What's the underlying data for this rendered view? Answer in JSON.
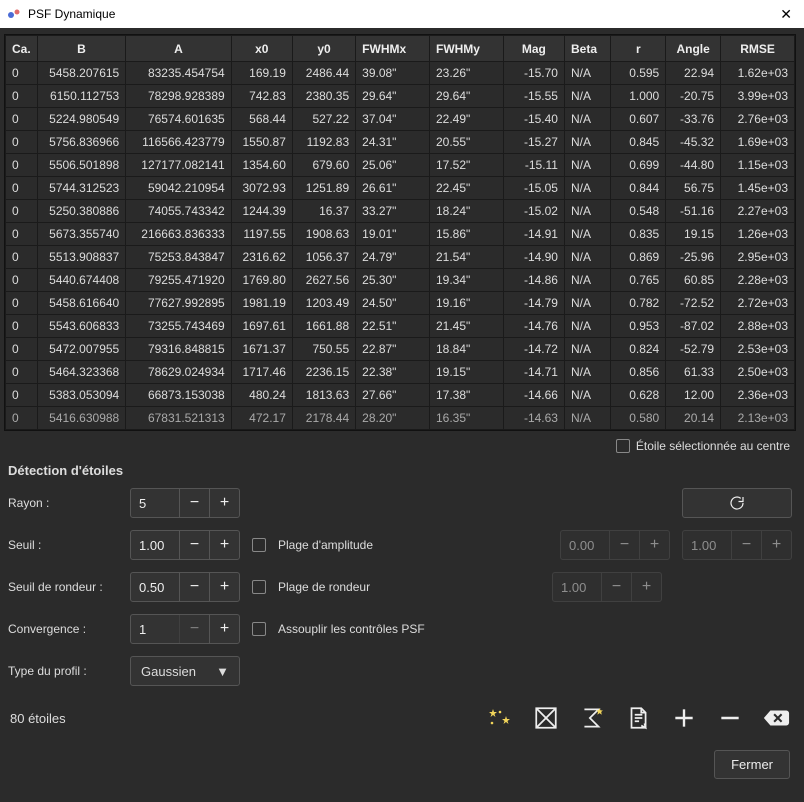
{
  "window": {
    "title": "PSF Dynamique"
  },
  "table": {
    "headers": [
      "Ca.",
      "B",
      "A",
      "x0",
      "y0",
      "FWHMx",
      "FWHMy",
      "Mag",
      "Beta",
      "r",
      "Angle",
      "RMSE"
    ],
    "rows": [
      {
        "ca": "0",
        "b": "5458.207615",
        "a": "83235.454754",
        "x0": "169.19",
        "y0": "2486.44",
        "fx": "39.08\"",
        "fy": "23.26\"",
        "mag": "-15.70",
        "beta": "N/A",
        "r": "0.595",
        "ang": "22.94",
        "rmse": "1.62e+03"
      },
      {
        "ca": "0",
        "b": "6150.112753",
        "a": "78298.928389",
        "x0": "742.83",
        "y0": "2380.35",
        "fx": "29.64\"",
        "fy": "29.64\"",
        "mag": "-15.55",
        "beta": "N/A",
        "r": "1.000",
        "ang": "-20.75",
        "rmse": "3.99e+03"
      },
      {
        "ca": "0",
        "b": "5224.980549",
        "a": "76574.601635",
        "x0": "568.44",
        "y0": "527.22",
        "fx": "37.04\"",
        "fy": "22.49\"",
        "mag": "-15.40",
        "beta": "N/A",
        "r": "0.607",
        "ang": "-33.76",
        "rmse": "2.76e+03"
      },
      {
        "ca": "0",
        "b": "5756.836966",
        "a": "116566.423779",
        "x0": "1550.87",
        "y0": "1192.83",
        "fx": "24.31\"",
        "fy": "20.55\"",
        "mag": "-15.27",
        "beta": "N/A",
        "r": "0.845",
        "ang": "-45.32",
        "rmse": "1.69e+03"
      },
      {
        "ca": "0",
        "b": "5506.501898",
        "a": "127177.082141",
        "x0": "1354.60",
        "y0": "679.60",
        "fx": "25.06\"",
        "fy": "17.52\"",
        "mag": "-15.11",
        "beta": "N/A",
        "r": "0.699",
        "ang": "-44.80",
        "rmse": "1.15e+03"
      },
      {
        "ca": "0",
        "b": "5744.312523",
        "a": "59042.210954",
        "x0": "3072.93",
        "y0": "1251.89",
        "fx": "26.61\"",
        "fy": "22.45\"",
        "mag": "-15.05",
        "beta": "N/A",
        "r": "0.844",
        "ang": "56.75",
        "rmse": "1.45e+03"
      },
      {
        "ca": "0",
        "b": "5250.380886",
        "a": "74055.743342",
        "x0": "1244.39",
        "y0": "16.37",
        "fx": "33.27\"",
        "fy": "18.24\"",
        "mag": "-15.02",
        "beta": "N/A",
        "r": "0.548",
        "ang": "-51.16",
        "rmse": "2.27e+03"
      },
      {
        "ca": "0",
        "b": "5673.355740",
        "a": "216663.836333",
        "x0": "1197.55",
        "y0": "1908.63",
        "fx": "19.01\"",
        "fy": "15.86\"",
        "mag": "-14.91",
        "beta": "N/A",
        "r": "0.835",
        "ang": "19.15",
        "rmse": "1.26e+03"
      },
      {
        "ca": "0",
        "b": "5513.908837",
        "a": "75253.843847",
        "x0": "2316.62",
        "y0": "1056.37",
        "fx": "24.79\"",
        "fy": "21.54\"",
        "mag": "-14.90",
        "beta": "N/A",
        "r": "0.869",
        "ang": "-25.96",
        "rmse": "2.95e+03"
      },
      {
        "ca": "0",
        "b": "5440.674408",
        "a": "79255.471920",
        "x0": "1769.80",
        "y0": "2627.56",
        "fx": "25.30\"",
        "fy": "19.34\"",
        "mag": "-14.86",
        "beta": "N/A",
        "r": "0.765",
        "ang": "60.85",
        "rmse": "2.28e+03"
      },
      {
        "ca": "0",
        "b": "5458.616640",
        "a": "77627.992895",
        "x0": "1981.19",
        "y0": "1203.49",
        "fx": "24.50\"",
        "fy": "19.16\"",
        "mag": "-14.79",
        "beta": "N/A",
        "r": "0.782",
        "ang": "-72.52",
        "rmse": "2.72e+03"
      },
      {
        "ca": "0",
        "b": "5543.606833",
        "a": "73255.743469",
        "x0": "1697.61",
        "y0": "1661.88",
        "fx": "22.51\"",
        "fy": "21.45\"",
        "mag": "-14.76",
        "beta": "N/A",
        "r": "0.953",
        "ang": "-87.02",
        "rmse": "2.88e+03"
      },
      {
        "ca": "0",
        "b": "5472.007955",
        "a": "79316.848815",
        "x0": "1671.37",
        "y0": "750.55",
        "fx": "22.87\"",
        "fy": "18.84\"",
        "mag": "-14.72",
        "beta": "N/A",
        "r": "0.824",
        "ang": "-52.79",
        "rmse": "2.53e+03"
      },
      {
        "ca": "0",
        "b": "5464.323368",
        "a": "78629.024934",
        "x0": "1717.46",
        "y0": "2236.15",
        "fx": "22.38\"",
        "fy": "19.15\"",
        "mag": "-14.71",
        "beta": "N/A",
        "r": "0.856",
        "ang": "61.33",
        "rmse": "2.50e+03"
      },
      {
        "ca": "0",
        "b": "5383.053094",
        "a": "66873.153038",
        "x0": "480.24",
        "y0": "1813.63",
        "fx": "27.66\"",
        "fy": "17.38\"",
        "mag": "-14.66",
        "beta": "N/A",
        "r": "0.628",
        "ang": "12.00",
        "rmse": "2.36e+03"
      },
      {
        "ca": "0",
        "b": "5416.630988",
        "a": "67831.521313",
        "x0": "472.17",
        "y0": "2178.44",
        "fx": "28.20\"",
        "fy": "16.35\"",
        "mag": "-14.63",
        "beta": "N/A",
        "r": "0.580",
        "ang": "20.14",
        "rmse": "2.13e+03"
      }
    ]
  },
  "checkbox_center": "Étoile sélectionnée au centre",
  "section": "Détection d'étoiles",
  "labels": {
    "rayon": "Rayon :",
    "seuil": "Seuil :",
    "rondeur": "Seuil de rondeur :",
    "convergence": "Convergence :",
    "profil": "Type du profil :",
    "plage_amp": "Plage d'amplitude",
    "plage_rond": "Plage de rondeur",
    "assouplir": "Assouplir les contrôles PSF"
  },
  "values": {
    "rayon": "5",
    "seuil": "1.00",
    "rondeur": "0.50",
    "convergence": "1",
    "profil": "Gaussien",
    "amp_lo": "0.00",
    "amp_hi": "1.00",
    "rond_hi": "1.00"
  },
  "status": "80 étoiles",
  "close": "Fermer"
}
